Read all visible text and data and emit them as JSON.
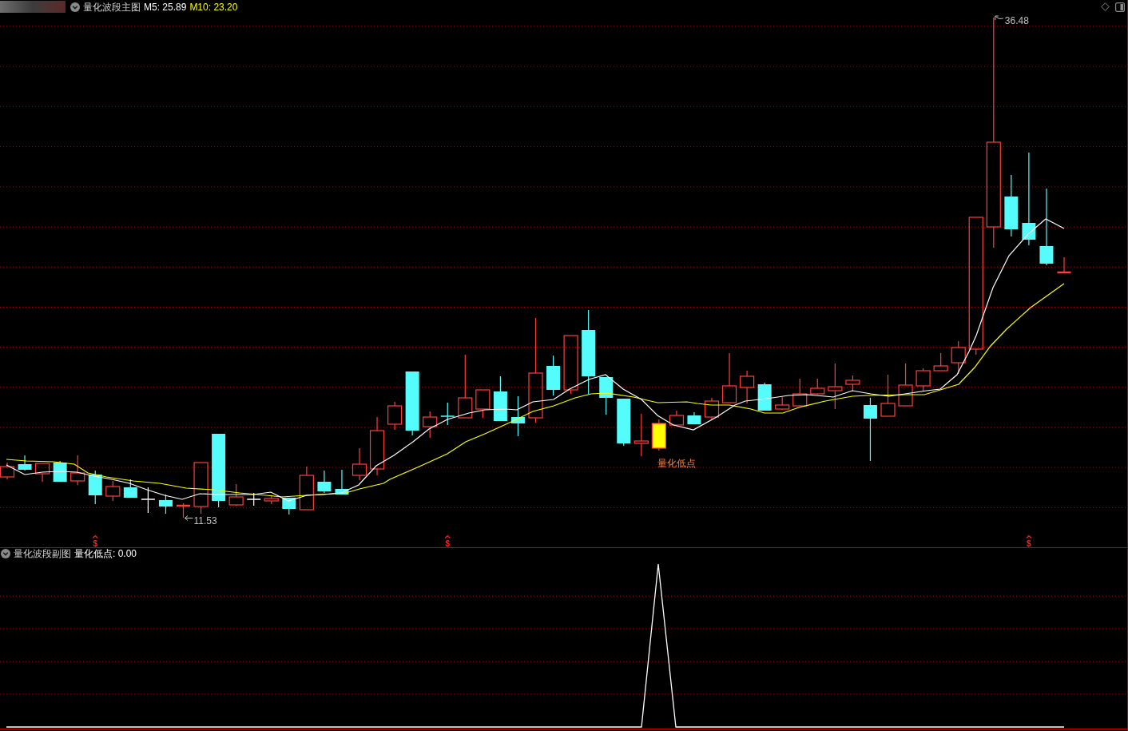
{
  "main_panel": {
    "title": "量化波段主图",
    "indicators": [
      {
        "label": "M5: 25.89",
        "color": "#ffffff"
      },
      {
        "label": "M10: 23.20",
        "color": "#ffff00"
      }
    ],
    "chart": {
      "high_label": "36.48",
      "low_label": "11.53",
      "signal_label": "量化低点",
      "markers": [
        "$",
        "$",
        "$"
      ]
    }
  },
  "sub_panel": {
    "title": "量化波段副图",
    "reading": "量化低点: 0.00"
  }
}
